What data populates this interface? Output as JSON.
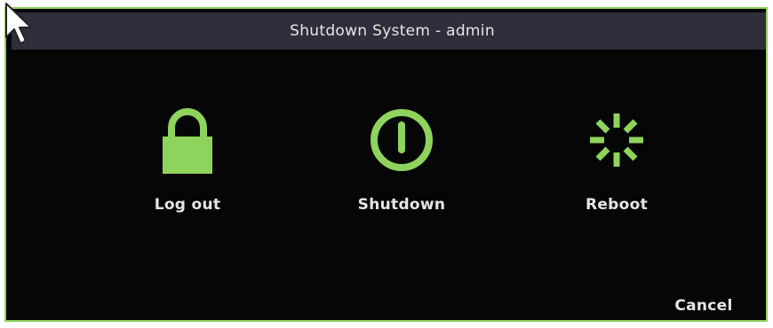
{
  "dialog": {
    "title": "Shutdown System - admin",
    "options": [
      {
        "label": "Log out",
        "icon": "lock-icon"
      },
      {
        "label": "Shutdown",
        "icon": "power-icon"
      },
      {
        "label": "Reboot",
        "icon": "reboot-icon"
      }
    ],
    "cancel_label": "Cancel"
  },
  "colors": {
    "accent": "#8ed35c",
    "background": "#060606",
    "titlebar": "#2f2f3b",
    "text": "#e6e6e6"
  }
}
